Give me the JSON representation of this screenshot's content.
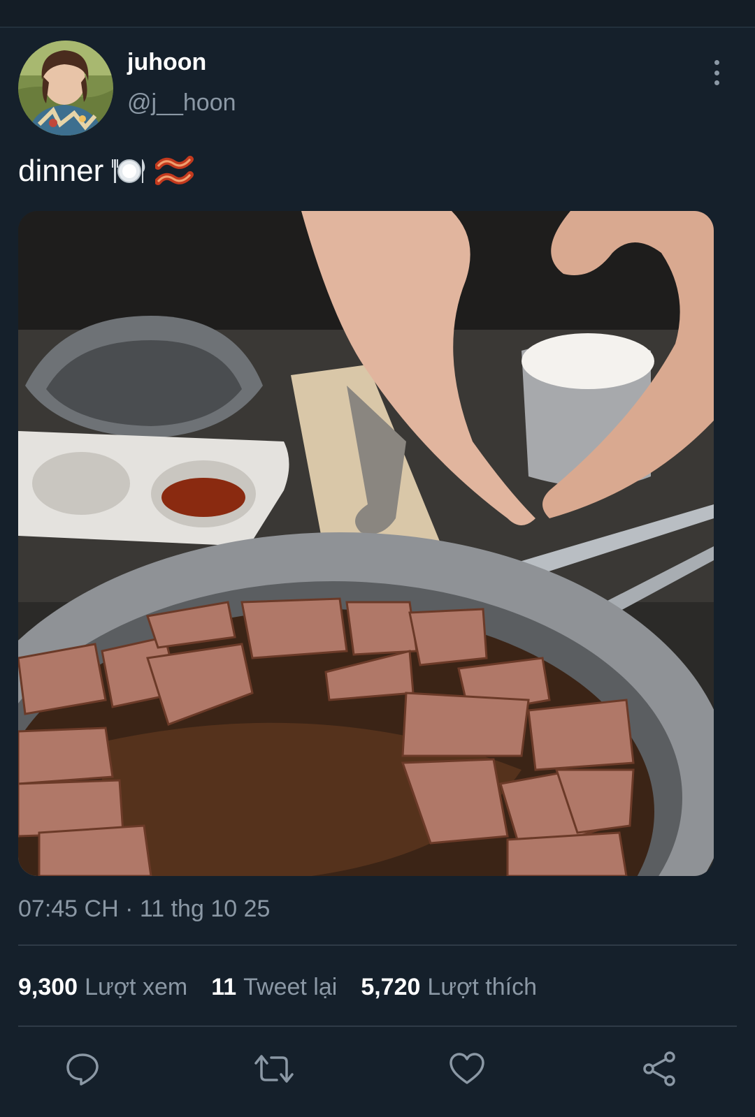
{
  "tweet": {
    "display_name": "juhoon",
    "handle": "@j__hoon",
    "text": "dinner",
    "emoji_icons": [
      "plate-cutlery-icon",
      "bacon-icon"
    ],
    "timestamp": "07:45 CH · 11 thg 10 25"
  },
  "stats": {
    "views_count": "9,300",
    "views_label": "Lượt xem",
    "retweets_count": "11",
    "retweets_label": "Tweet lại",
    "likes_count": "5,720",
    "likes_label": "Lượt thích"
  },
  "actions": [
    "reply-icon",
    "retweet-icon",
    "like-icon",
    "share-icon"
  ],
  "colors": {
    "background": "#15202b",
    "secondary_text": "#8b98a5",
    "divider": "#2f3b47"
  }
}
